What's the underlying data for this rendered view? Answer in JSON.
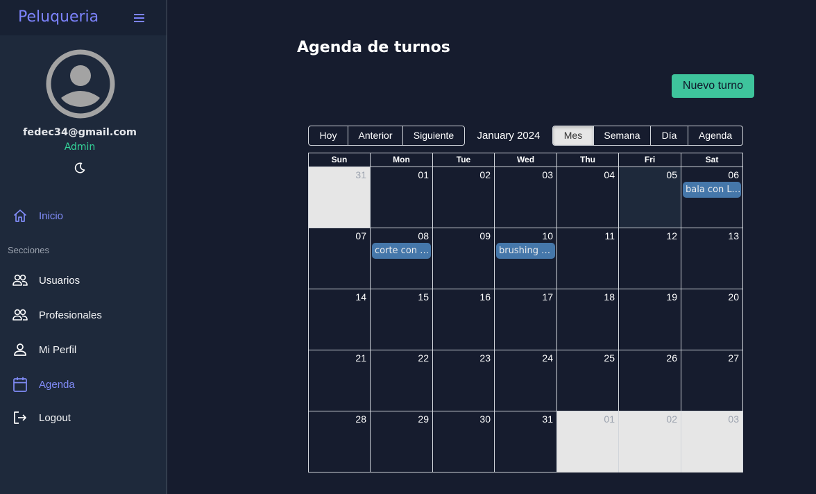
{
  "sidebar": {
    "brand": "Peluqueria",
    "user": {
      "email": "fedec34@gmail.com",
      "role": "Admin"
    },
    "nav_home": "Inicio",
    "section_label": "Secciones",
    "items": [
      {
        "label": "Usuarios",
        "icon": "users-icon"
      },
      {
        "label": "Profesionales",
        "icon": "users-icon"
      },
      {
        "label": "Mi Perfil",
        "icon": "user-icon"
      },
      {
        "label": "Agenda",
        "icon": "calendar-icon",
        "active": true
      },
      {
        "label": "Logout",
        "icon": "logout-icon"
      }
    ]
  },
  "main": {
    "title": "Agenda de turnos",
    "new_button": "Nuevo turno"
  },
  "calendar": {
    "nav_buttons": [
      "Hoy",
      "Anterior",
      "Siguiente"
    ],
    "label": "January 2024",
    "views": [
      "Mes",
      "Semana",
      "Día",
      "Agenda"
    ],
    "active_view": "Mes",
    "weekdays": [
      "Sun",
      "Mon",
      "Tue",
      "Wed",
      "Thu",
      "Fri",
      "Sat"
    ],
    "weeks": [
      [
        {
          "d": "31",
          "off": true
        },
        {
          "d": "01"
        },
        {
          "d": "02"
        },
        {
          "d": "03"
        },
        {
          "d": "04"
        },
        {
          "d": "05",
          "today": true
        },
        {
          "d": "06",
          "event": "bala con Luis"
        }
      ],
      [
        {
          "d": "07"
        },
        {
          "d": "08",
          "event": "corte con Juan"
        },
        {
          "d": "09"
        },
        {
          "d": "10",
          "event": "brushing con Ana"
        },
        {
          "d": "11"
        },
        {
          "d": "12"
        },
        {
          "d": "13"
        }
      ],
      [
        {
          "d": "14"
        },
        {
          "d": "15"
        },
        {
          "d": "16"
        },
        {
          "d": "17"
        },
        {
          "d": "18"
        },
        {
          "d": "19"
        },
        {
          "d": "20"
        }
      ],
      [
        {
          "d": "21"
        },
        {
          "d": "22"
        },
        {
          "d": "23"
        },
        {
          "d": "24"
        },
        {
          "d": "25"
        },
        {
          "d": "26"
        },
        {
          "d": "27"
        }
      ],
      [
        {
          "d": "28"
        },
        {
          "d": "29"
        },
        {
          "d": "30"
        },
        {
          "d": "31"
        },
        {
          "d": "01",
          "off": true
        },
        {
          "d": "02",
          "off": true
        },
        {
          "d": "03",
          "off": true
        }
      ]
    ]
  },
  "colors": {
    "accent": "#818cf8",
    "brand": "#7c83fd",
    "role": "#34d399",
    "primary_button": "#3ec49c",
    "event": "#4a7fb5",
    "background": "#161c2e",
    "sidebar": "#1e293b"
  }
}
